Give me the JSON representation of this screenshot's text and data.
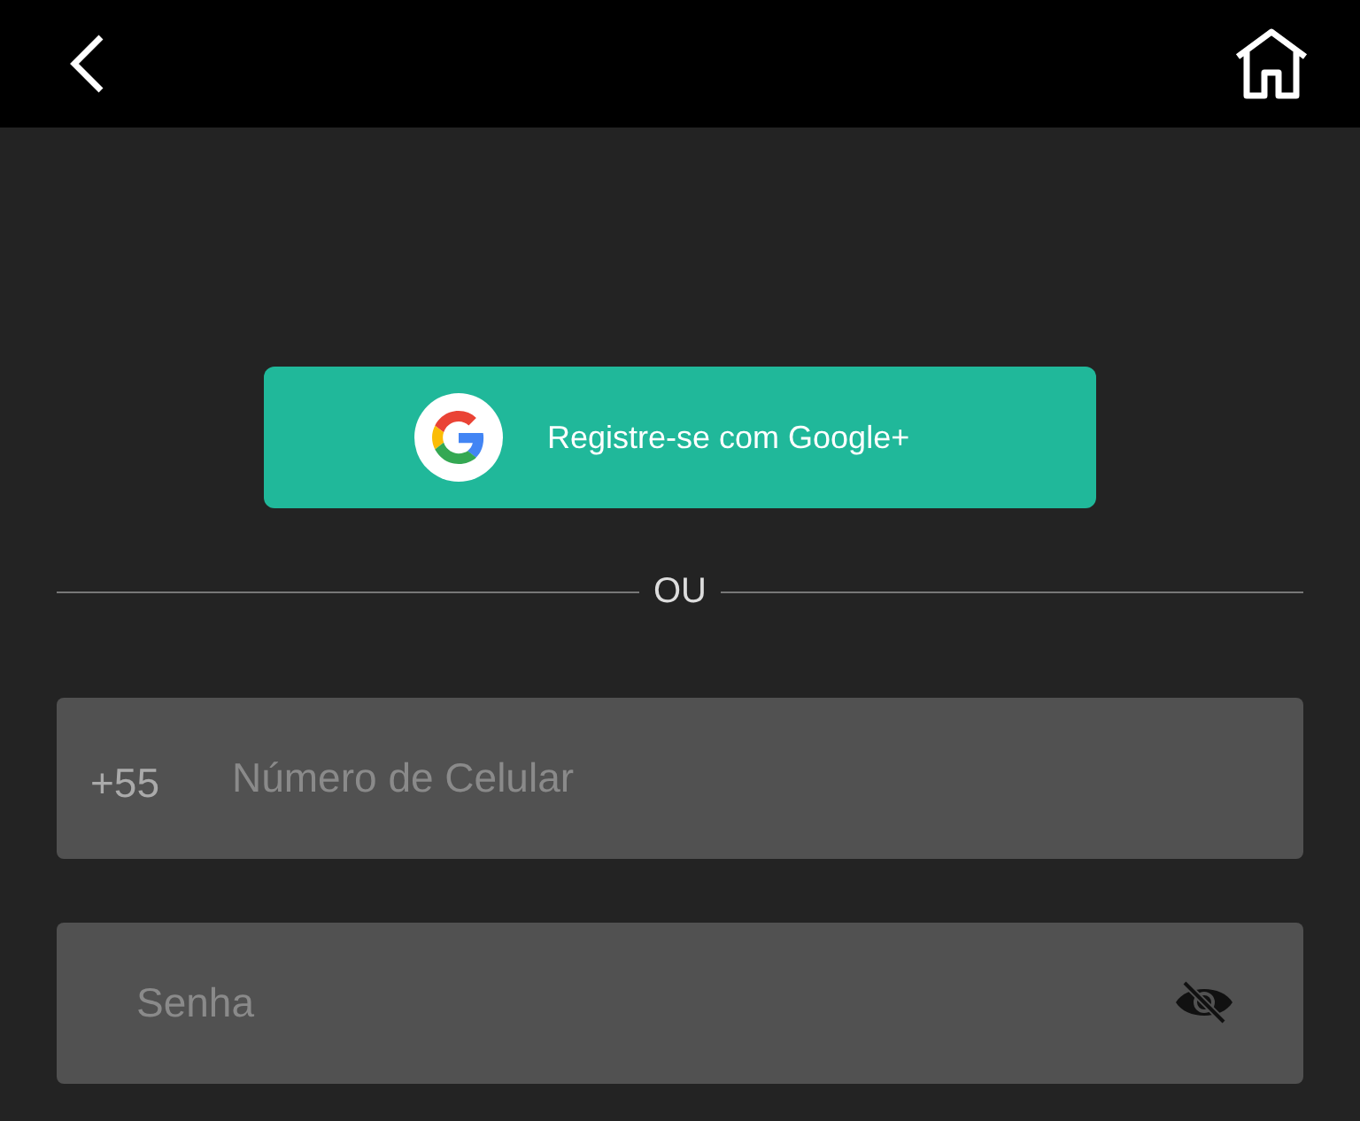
{
  "google_button": {
    "label": "Registre-se com Google+"
  },
  "divider": {
    "label": "OU"
  },
  "phone_field": {
    "country_code": "+55",
    "placeholder": "Número de Celular"
  },
  "password_field": {
    "placeholder": "Senha"
  }
}
